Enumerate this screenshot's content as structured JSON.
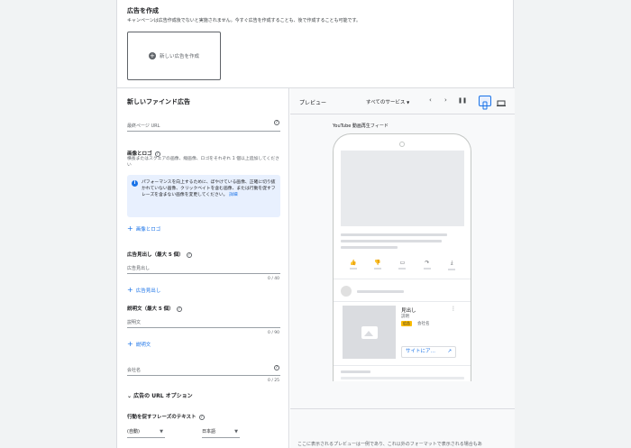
{
  "create": {
    "title": "広告を作成",
    "subtitle": "キャンペーンは広告作成後でないと実施されません。今すぐ広告を作成することも、後で作成することも可能です。",
    "new_ad_label": "新しい広告を作成"
  },
  "editor": {
    "title": "新しいファインド広告",
    "final_url_placeholder": "最終ページ URL",
    "images": {
      "title": "画像とロゴ",
      "description": "横長またはスクエアの画像、縦画像、ロゴをそれぞれ 1 個以上追加してください",
      "info": "パフォーマンスを向上するために、ぼやけている画像、正確に切り抜かれていない画像、クリックベイトを含む画像、または行動を促すフレーズを含まない画像を変更してください。",
      "info_link": "詳細",
      "add_label": "画像とロゴ"
    },
    "headlines": {
      "title": "広告見出し（最大 5 個）",
      "placeholder": "広告見出し",
      "counter": "0 / 40",
      "add_label": "広告見出し"
    },
    "descriptions": {
      "title": "説明文（最大 5 個）",
      "placeholder": "説明文",
      "counter": "0 / 90",
      "add_label": "説明文"
    },
    "company": {
      "placeholder": "会社名",
      "counter": "0 / 25"
    },
    "url_options_label": "広告の URL オプション",
    "cta": {
      "title": "行動を促すフレーズのテキスト",
      "select_value": "(自動)",
      "language_value": "日本語"
    }
  },
  "preview": {
    "title": "プレビュー",
    "services_label": "すべてのサービス",
    "feed_label": "YouTube 動画再生フィード",
    "ad": {
      "headline": "見出し",
      "description": "説明",
      "badge": "広告",
      "company": "会社名",
      "cta_label": "サイトにア…"
    },
    "footer": "ここに表示されるプレビューは一例であり、これ以外のフォーマットで表示される場合もあ"
  },
  "colors": {
    "accent": "#1a73e8",
    "badge": "#fbbc04"
  }
}
